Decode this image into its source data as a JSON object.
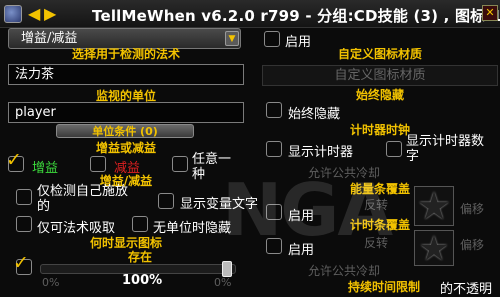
{
  "title": "TellMeWhen v6.2.0 r799 - 分组:CD技能 (3) , 图标:1",
  "type_dropdown": {
    "value": "增益/减益"
  },
  "left": {
    "spell_heading": "选择用于检测的法术",
    "spell_value": "法力茶",
    "unit_heading": "监视的单位",
    "unit_value": "player",
    "unit_conditions_button": "单位条件 (0)",
    "buff_type_heading": "增益或减益",
    "buff_label": "增益",
    "debuff_label": "减益",
    "any_label": "任意一种",
    "buff_debuff_heading": "增益/减益",
    "only_mine_label": "仅检测自己施放的",
    "show_variable_text_label": "显示变量文字",
    "only_stealable_label": "仅可法术吸取",
    "hide_no_unit_label": "无单位时隐藏",
    "when_show_heading": "何时显示图标",
    "present_label": "存在",
    "slider_min": "0%",
    "slider_value": "100%",
    "slider_max": "0%"
  },
  "right": {
    "enabled_label": "启用",
    "custom_tex_heading": "自定义图标材质",
    "custom_tex_placeholder": "自定义图标材质",
    "always_hide_heading": "始终隐藏",
    "always_hide_label": "始终隐藏",
    "timer_clock_heading": "计时器时钟",
    "show_timer_label": "显示计时器",
    "show_timer_text_label": "显示计时器数字",
    "allow_gcd_label": "允许公共冷却",
    "energy_bar_heading": "能量条覆盖",
    "enabled2_label": "启用",
    "reverse_label": "反转",
    "offset_label": "偏移",
    "timer_bar_heading": "计时条覆盖",
    "enabled3_label": "启用",
    "reverse2_label": "反转",
    "offset2_label": "偏移",
    "allow_gcd2_label": "允许公共冷却",
    "duration_limit_heading": "持续时间限制",
    "opacity_label": "的不透明"
  },
  "watermark": "NGA",
  "colors": {
    "accent": "#f2c200",
    "buff": "#3cdc3c",
    "debuff": "#e02020"
  }
}
